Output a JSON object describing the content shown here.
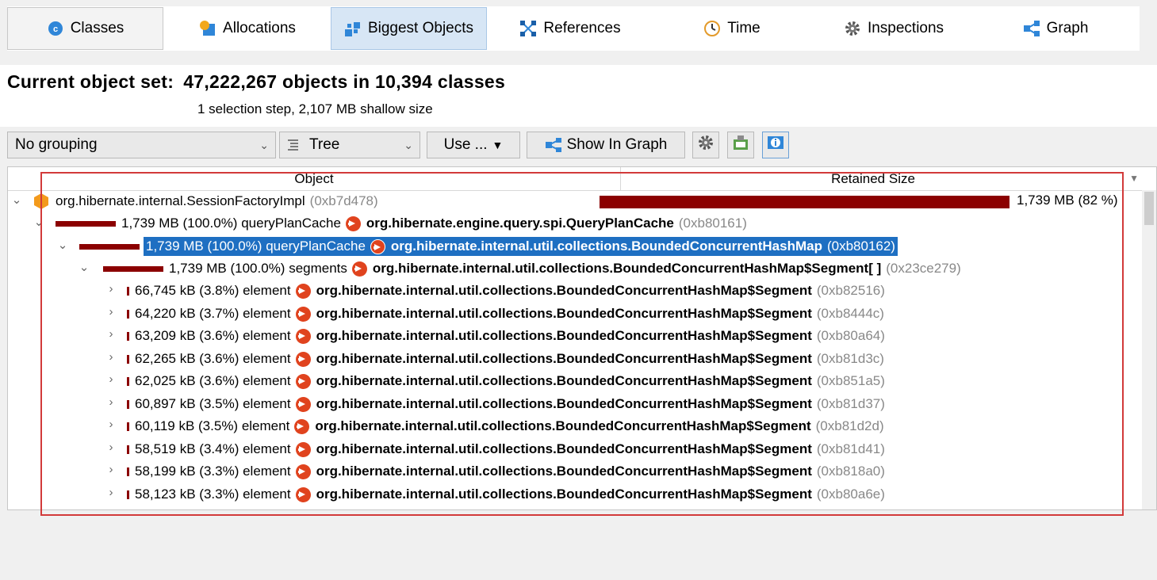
{
  "tabs": [
    {
      "label": "Classes",
      "icon": "classes-icon"
    },
    {
      "label": "Allocations",
      "icon": "allocations-icon"
    },
    {
      "label": "Biggest Objects",
      "icon": "biggest-objects-icon"
    },
    {
      "label": "References",
      "icon": "references-icon"
    },
    {
      "label": "Time",
      "icon": "clock-icon"
    },
    {
      "label": "Inspections",
      "icon": "gear-icon"
    },
    {
      "label": "Graph",
      "icon": "graph-icon"
    }
  ],
  "header": {
    "title_label": "Current object set:",
    "title_value": "47,222,267 objects in 10,394 classes",
    "subtitle": "1 selection step, 2,107 MB shallow size"
  },
  "toolbar": {
    "grouping": "No grouping",
    "view": "Tree",
    "use_label": "Use ...",
    "show_in_graph": "Show In Graph"
  },
  "table": {
    "col_object": "Object",
    "col_retained": "Retained Size",
    "root": {
      "cls": "org.hibernate.internal.SessionFactoryImpl",
      "addr": "(0xb7d478)",
      "retained": "1,739 MB (82 %)",
      "retained_fraction": 0.82
    },
    "level1": {
      "size": "1,739 MB (100.0%)",
      "field": "queryPlanCache",
      "cls": "org.hibernate.engine.query.spi.QueryPlanCache",
      "addr": "(0xb80161)"
    },
    "level2": {
      "size": "1,739 MB (100.0%)",
      "field": "queryPlanCache",
      "cls": "org.hibernate.internal.util.collections.BoundedConcurrentHashMap",
      "addr": "(0xb80162)"
    },
    "level3": {
      "size": "1,739 MB (100.0%)",
      "field": "segments",
      "cls": "org.hibernate.internal.util.collections.BoundedConcurrentHashMap$Segment[ ]",
      "addr": "(0x23ce279)"
    },
    "elements": [
      {
        "size": "66,745 kB (3.8%)",
        "field": "element",
        "cls": "org.hibernate.internal.util.collections.BoundedConcurrentHashMap$Segment",
        "addr": "(0xb82516)"
      },
      {
        "size": "64,220 kB (3.7%)",
        "field": "element",
        "cls": "org.hibernate.internal.util.collections.BoundedConcurrentHashMap$Segment",
        "addr": "(0xb8444c)"
      },
      {
        "size": "63,209 kB (3.6%)",
        "field": "element",
        "cls": "org.hibernate.internal.util.collections.BoundedConcurrentHashMap$Segment",
        "addr": "(0xb80a64)"
      },
      {
        "size": "62,265 kB (3.6%)",
        "field": "element",
        "cls": "org.hibernate.internal.util.collections.BoundedConcurrentHashMap$Segment",
        "addr": "(0xb81d3c)"
      },
      {
        "size": "62,025 kB (3.6%)",
        "field": "element",
        "cls": "org.hibernate.internal.util.collections.BoundedConcurrentHashMap$Segment",
        "addr": "(0xb851a5)"
      },
      {
        "size": "60,897 kB (3.5%)",
        "field": "element",
        "cls": "org.hibernate.internal.util.collections.BoundedConcurrentHashMap$Segment",
        "addr": "(0xb81d37)"
      },
      {
        "size": "60,119 kB (3.5%)",
        "field": "element",
        "cls": "org.hibernate.internal.util.collections.BoundedConcurrentHashMap$Segment",
        "addr": "(0xb81d2d)"
      },
      {
        "size": "58,519 kB (3.4%)",
        "field": "element",
        "cls": "org.hibernate.internal.util.collections.BoundedConcurrentHashMap$Segment",
        "addr": "(0xb81d41)"
      },
      {
        "size": "58,199 kB (3.3%)",
        "field": "element",
        "cls": "org.hibernate.internal.util.collections.BoundedConcurrentHashMap$Segment",
        "addr": "(0xb818a0)"
      },
      {
        "size": "58,123 kB (3.3%)",
        "field": "element",
        "cls": "org.hibernate.internal.util.collections.BoundedConcurrentHashMap$Segment",
        "addr": "(0xb80a6e)"
      }
    ]
  },
  "colors": {
    "bar": "#8b0000",
    "selection": "#1e6fc2",
    "highlight_box": "#d23a3a",
    "arrow_icon": "#e0431e"
  }
}
